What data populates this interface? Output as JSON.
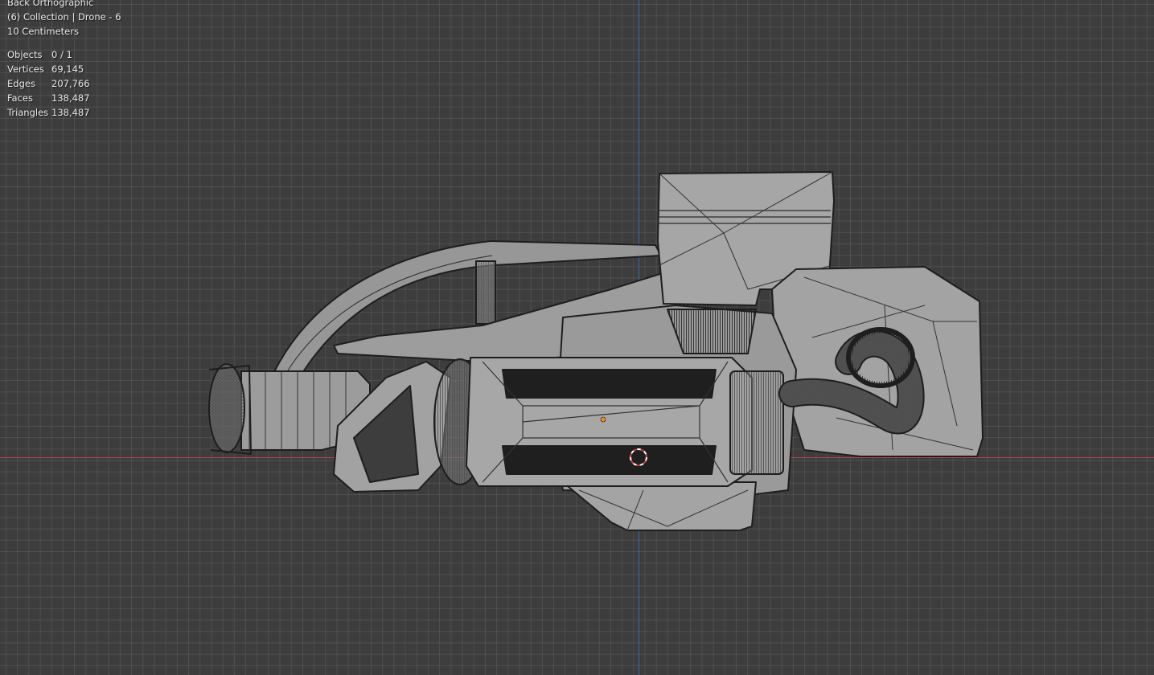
{
  "viewport": {
    "view_name": "Back Orthographic",
    "collection_info": "(6) Collection | Drone - 6",
    "scale": "10 Centimeters",
    "stats": [
      {
        "label": "Objects",
        "value": "0 / 1"
      },
      {
        "label": "Vertices",
        "value": "69,145"
      },
      {
        "label": "Edges",
        "value": "207,766"
      },
      {
        "label": "Faces",
        "value": "138,487"
      },
      {
        "label": "Triangles",
        "value": "138,487"
      }
    ]
  },
  "colors": {
    "background": "#3d3d3d",
    "x_axis": "#b3474b",
    "y_axis": "#3d6fb6",
    "mesh_fill": "#9b9b9b",
    "wire": "#1e1e1e",
    "origin": "#f28c1e"
  }
}
